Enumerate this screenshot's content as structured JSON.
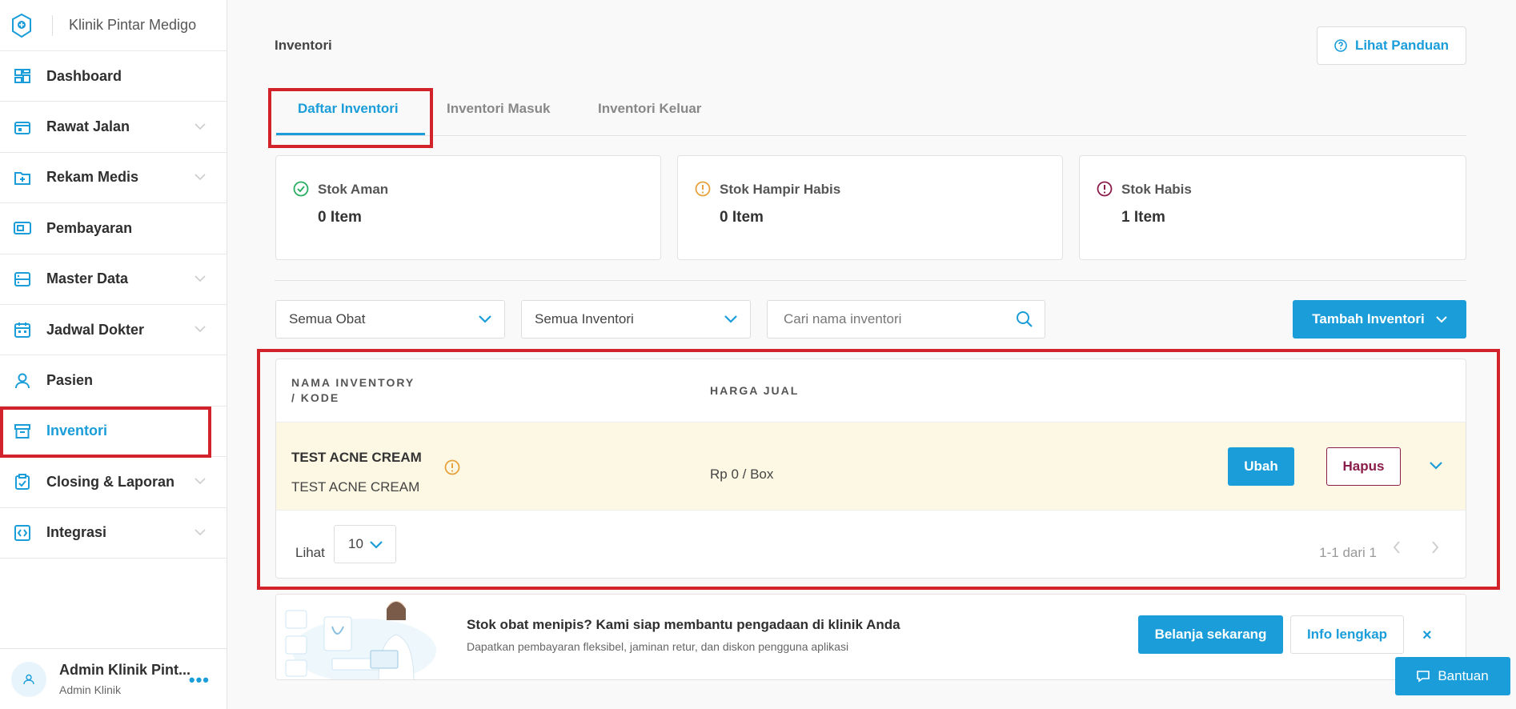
{
  "sidebar": {
    "clinic_name": "Klinik Pintar Medigo",
    "items": [
      {
        "label": "Dashboard",
        "icon": "dashboard-icon",
        "has_chevron": false
      },
      {
        "label": "Rawat Jalan",
        "icon": "outpatient-icon",
        "has_chevron": true
      },
      {
        "label": "Rekam Medis",
        "icon": "medical-record-icon",
        "has_chevron": true
      },
      {
        "label": "Pembayaran",
        "icon": "payment-icon",
        "has_chevron": false
      },
      {
        "label": "Master Data",
        "icon": "master-data-icon",
        "has_chevron": true
      },
      {
        "label": "Jadwal Dokter",
        "icon": "calendar-icon",
        "has_chevron": true
      },
      {
        "label": "Pasien",
        "icon": "patient-icon",
        "has_chevron": false
      },
      {
        "label": "Inventori",
        "icon": "inventory-icon",
        "has_chevron": false,
        "active": true
      },
      {
        "label": "Closing & Laporan",
        "icon": "report-icon",
        "has_chevron": true
      },
      {
        "label": "Integrasi",
        "icon": "integration-icon",
        "has_chevron": true
      }
    ],
    "user": {
      "name": "Admin Klinik Pint...",
      "role": "Admin Klinik"
    }
  },
  "header": {
    "title": "Inventori",
    "guide_label": "Lihat Panduan"
  },
  "tabs": [
    {
      "label": "Daftar Inventori",
      "active": true
    },
    {
      "label": "Inventori Masuk",
      "active": false
    },
    {
      "label": "Inventori Keluar",
      "active": false
    }
  ],
  "stats": [
    {
      "title": "Stok Aman",
      "value": "0 Item",
      "icon": "check-circle-icon",
      "color": "#27ae60"
    },
    {
      "title": "Stok Hampir Habis",
      "value": "0 Item",
      "icon": "warning-circle-icon",
      "color": "#e6a23c"
    },
    {
      "title": "Stok Habis",
      "value": "1 Item",
      "icon": "alert-circle-icon",
      "color": "#8a1c4a"
    }
  ],
  "filters": {
    "obat_selected": "Semua Obat",
    "inventori_selected": "Semua Inventori",
    "search_placeholder": "Cari nama inventori",
    "add_label": "Tambah Inventori"
  },
  "table": {
    "col_name": [
      "NAMA INVENTORY",
      "/ KODE"
    ],
    "col_price": "HARGA JUAL",
    "rows": [
      {
        "name": "TEST ACNE CREAM",
        "code": "TEST ACNE CREAM",
        "price": "Rp 0 / Box",
        "edit_label": "Ubah",
        "delete_label": "Hapus"
      }
    ],
    "pagination": {
      "label": "Lihat",
      "page_size": "10",
      "range": "1-1 dari 1"
    }
  },
  "banner": {
    "title": "Stok obat menipis? Kami siap membantu pengadaan di klinik Anda",
    "subtitle": "Dapatkan pembayaran fleksibel, jaminan retur, dan diskon pengguna aplikasi",
    "shop_label": "Belanja sekarang",
    "info_label": "Info lengkap",
    "close_label": "×"
  },
  "help_label": "Bantuan",
  "colors": {
    "accent": "#1a9dd9",
    "highlight": "#d3232a",
    "danger": "#8a1c4a",
    "row_warning_bg": "#fcf8e3"
  }
}
